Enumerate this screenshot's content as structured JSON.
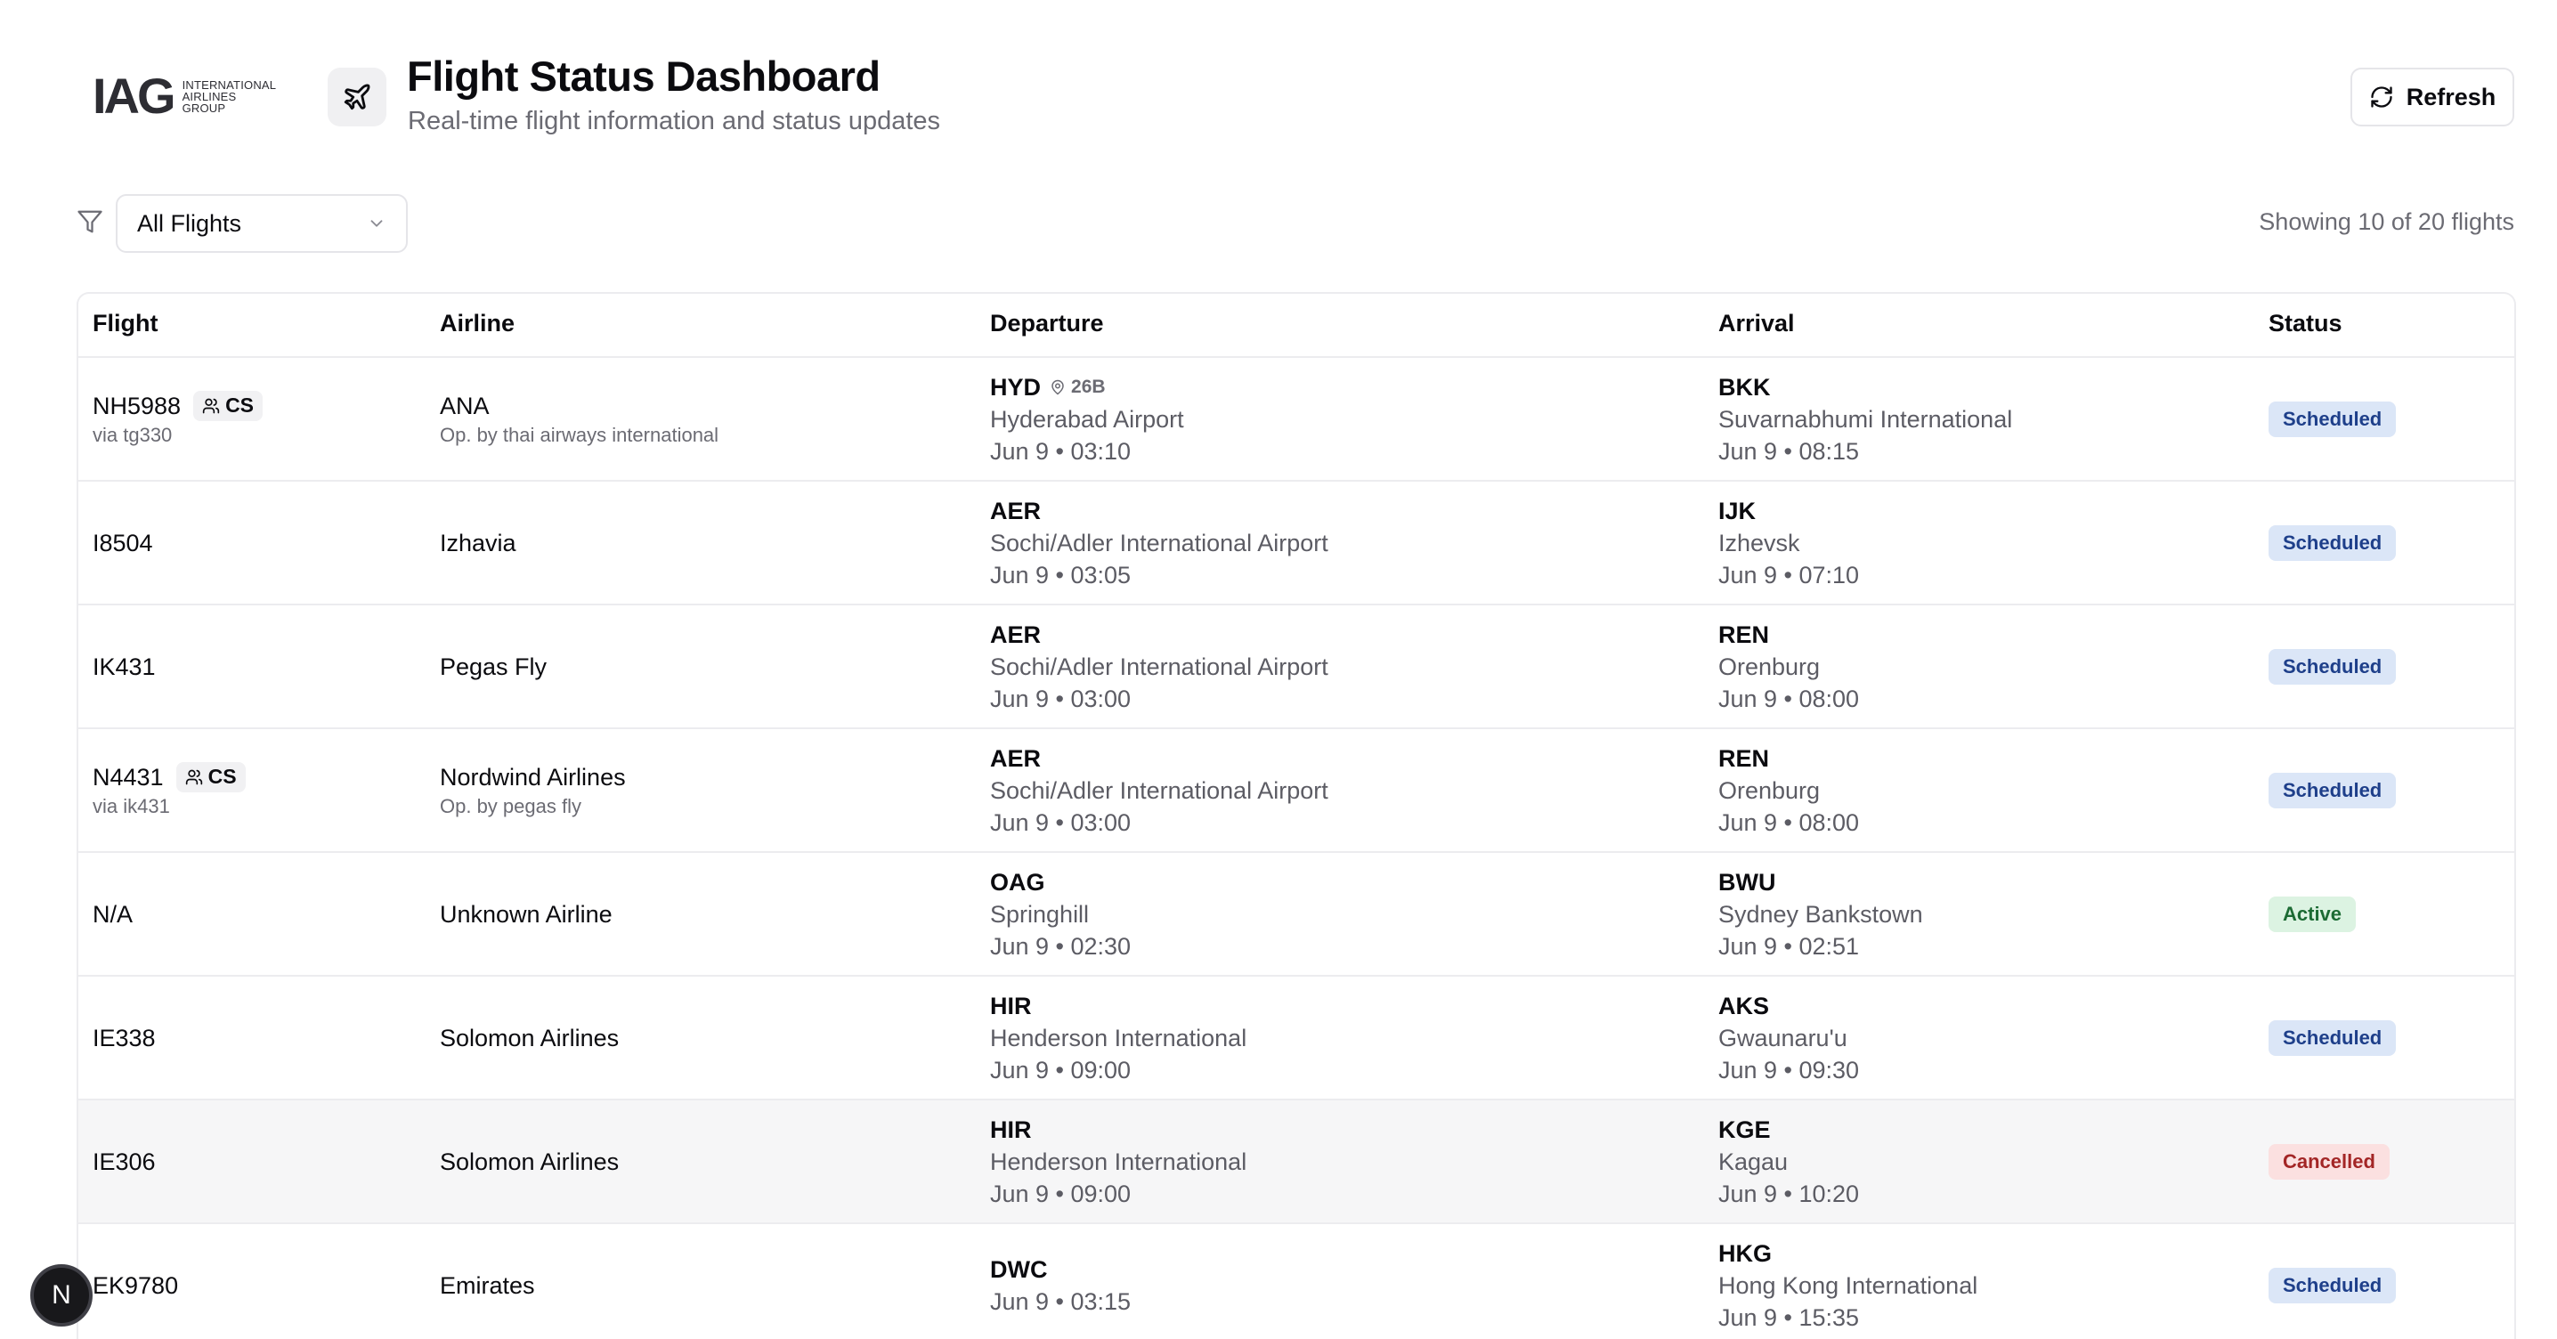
{
  "header": {
    "logo_mark": "IAG",
    "logo_lines": [
      "INTERNATIONAL",
      "AIRLINES",
      "GROUP"
    ],
    "title": "Flight Status Dashboard",
    "subtitle": "Real-time flight information and status updates",
    "refresh_label": "Refresh"
  },
  "filter": {
    "selected": "All Flights",
    "showing": "Showing 10 of 20 flights"
  },
  "table": {
    "columns": [
      "Flight",
      "Airline",
      "Departure",
      "Arrival",
      "Status"
    ],
    "rows": [
      {
        "flight": "NH5988",
        "codeshare": "CS",
        "via": "via tg330",
        "airline": "ANA",
        "operated_by": "Op. by thai airways international",
        "dep_code": "HYD",
        "dep_gate": "26B",
        "dep_airport": "Hyderabad Airport",
        "dep_time": "Jun 9 • 03:10",
        "arr_code": "BKK",
        "arr_airport": "Suvarnabhumi International",
        "arr_time": "Jun 9 • 08:15",
        "status": "Scheduled"
      },
      {
        "flight": "I8504",
        "codeshare": "",
        "via": "",
        "airline": "Izhavia",
        "operated_by": "",
        "dep_code": "AER",
        "dep_gate": "",
        "dep_airport": "Sochi/Adler International Airport",
        "dep_time": "Jun 9 • 03:05",
        "arr_code": "IJK",
        "arr_airport": "Izhevsk",
        "arr_time": "Jun 9 • 07:10",
        "status": "Scheduled"
      },
      {
        "flight": "IK431",
        "codeshare": "",
        "via": "",
        "airline": "Pegas Fly",
        "operated_by": "",
        "dep_code": "AER",
        "dep_gate": "",
        "dep_airport": "Sochi/Adler International Airport",
        "dep_time": "Jun 9 • 03:00",
        "arr_code": "REN",
        "arr_airport": "Orenburg",
        "arr_time": "Jun 9 • 08:00",
        "status": "Scheduled"
      },
      {
        "flight": "N4431",
        "codeshare": "CS",
        "via": "via ik431",
        "airline": "Nordwind Airlines",
        "operated_by": "Op. by pegas fly",
        "dep_code": "AER",
        "dep_gate": "",
        "dep_airport": "Sochi/Adler International Airport",
        "dep_time": "Jun 9 • 03:00",
        "arr_code": "REN",
        "arr_airport": "Orenburg",
        "arr_time": "Jun 9 • 08:00",
        "status": "Scheduled"
      },
      {
        "flight": "N/A",
        "codeshare": "",
        "via": "",
        "airline": "Unknown Airline",
        "operated_by": "",
        "dep_code": "OAG",
        "dep_gate": "",
        "dep_airport": "Springhill",
        "dep_time": "Jun 9 • 02:30",
        "arr_code": "BWU",
        "arr_airport": "Sydney Bankstown",
        "arr_time": "Jun 9 • 02:51",
        "status": "Active"
      },
      {
        "flight": "IE338",
        "codeshare": "",
        "via": "",
        "airline": "Solomon Airlines",
        "operated_by": "",
        "dep_code": "HIR",
        "dep_gate": "",
        "dep_airport": "Henderson International",
        "dep_time": "Jun 9 • 09:00",
        "arr_code": "AKS",
        "arr_airport": "Gwaunaru'u",
        "arr_time": "Jun 9 • 09:30",
        "status": "Scheduled"
      },
      {
        "flight": "IE306",
        "codeshare": "",
        "via": "",
        "airline": "Solomon Airlines",
        "operated_by": "",
        "dep_code": "HIR",
        "dep_gate": "",
        "dep_airport": "Henderson International",
        "dep_time": "Jun 9 • 09:00",
        "arr_code": "KGE",
        "arr_airport": "Kagau",
        "arr_time": "Jun 9 • 10:20",
        "status": "Cancelled"
      },
      {
        "flight": "EK9780",
        "codeshare": "",
        "via": "",
        "airline": "Emirates",
        "operated_by": "",
        "dep_code": "DWC",
        "dep_gate": "",
        "dep_airport": "",
        "dep_time": "Jun 9 • 03:15",
        "arr_code": "HKG",
        "arr_airport": "Hong Kong International",
        "arr_time": "Jun 9 • 15:35",
        "status": "Scheduled"
      }
    ]
  },
  "fab": {
    "label": "N"
  },
  "colors": {
    "scheduled_bg": "#dbe6f7",
    "scheduled_fg": "#1e3f8a",
    "active_bg": "#dcf3e2",
    "active_fg": "#1c6b34",
    "cancelled_bg": "#fbe0e0",
    "cancelled_fg": "#a32626"
  },
  "icons": {
    "header": "plane-icon",
    "refresh": "refresh-icon",
    "filter": "filter-icon",
    "select": "chevron-down-icon",
    "codeshare": "users-icon",
    "gate": "map-pin-icon"
  }
}
